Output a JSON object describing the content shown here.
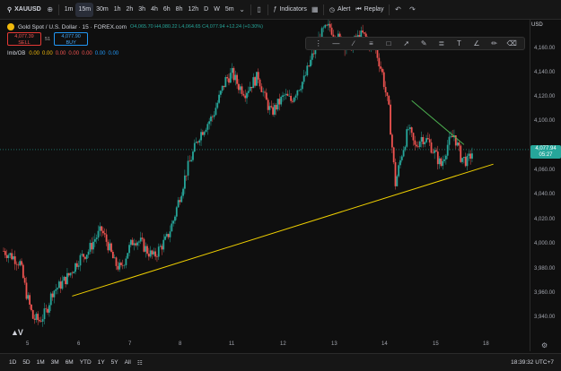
{
  "toolbar": {
    "symbol": "XAUUSD",
    "intervals": [
      "1m",
      "15m",
      "30m",
      "1h",
      "2h",
      "3h",
      "4h",
      "6h",
      "8h",
      "12h",
      "D",
      "W",
      "5m"
    ],
    "active_interval": "15m",
    "indicators_label": "Indicators",
    "alert_label": "Alert",
    "replay_label": "Replay"
  },
  "legend": {
    "title": "Gold Spot / U.S. Dollar · 15 · FOREX.com",
    "ohlc": "O4,065.70 H4,080.22 L4,064.65 C4,077.94 +12.24 (+0.30%)",
    "sell_price": "4,077.39",
    "sell_label": "SELL",
    "buy_price": "4,077.90",
    "buy_label": "BUY",
    "spread": "51",
    "indicator_name": "Imb/OB",
    "indicator_values": [
      "0.00",
      "0.00",
      "0.00",
      "0.00",
      "0.00",
      "0.00",
      "0.00"
    ]
  },
  "price_axis": {
    "currency": "USD",
    "labels": [
      "4,160.00",
      "4,140.00",
      "4,120.00",
      "4,100.00",
      "4,080.00",
      "4,060.00",
      "4,040.00",
      "4,020.00",
      "4,000.00",
      "3,980.00",
      "3,960.00",
      "3,940.00"
    ],
    "current_price": "4,077.94",
    "countdown": "05:27"
  },
  "time_axis": {
    "labels": [
      "5",
      "6",
      "7",
      "8",
      "11",
      "12",
      "13",
      "14",
      "15",
      "18"
    ]
  },
  "bottom_bar": {
    "ranges": [
      "1D",
      "5D",
      "1M",
      "3M",
      "6M",
      "YTD",
      "1Y",
      "5Y",
      "All"
    ],
    "clock": "18:39:32 UTC+7"
  },
  "colors": {
    "bull": "#26a69a",
    "bear": "#ef5350",
    "support_line": "#f0d000",
    "resistance_line": "#4caf50",
    "background": "#0f0f0f"
  },
  "chart_data": {
    "type": "candlestick",
    "symbol": "XAUUSD",
    "timeframe": "15",
    "ylim": [
      3930,
      4180
    ],
    "x_ticks": [
      "5",
      "6",
      "7",
      "8",
      "11",
      "12",
      "13",
      "14",
      "15",
      "18"
    ],
    "close_path": [
      [
        0,
        3995
      ],
      [
        3,
        3990
      ],
      [
        5,
        3985
      ],
      [
        7,
        3960
      ],
      [
        9,
        3940
      ],
      [
        11,
        3938
      ],
      [
        13,
        3945
      ],
      [
        15,
        3962
      ],
      [
        17,
        3966
      ],
      [
        20,
        3975
      ],
      [
        23,
        3988
      ],
      [
        26,
        3995
      ],
      [
        28,
        4005
      ],
      [
        30,
        4012
      ],
      [
        32,
        4000
      ],
      [
        34,
        3985
      ],
      [
        36,
        3980
      ],
      [
        38,
        3995
      ],
      [
        40,
        4005
      ],
      [
        42,
        4002
      ],
      [
        44,
        3995
      ],
      [
        46,
        3990
      ],
      [
        48,
        3998
      ],
      [
        50,
        4005
      ],
      [
        52,
        4020
      ],
      [
        54,
        4040
      ],
      [
        56,
        4060
      ],
      [
        58,
        4075
      ],
      [
        60,
        4090
      ],
      [
        62,
        4098
      ],
      [
        64,
        4105
      ],
      [
        66,
        4120
      ],
      [
        68,
        4135
      ],
      [
        70,
        4140
      ],
      [
        72,
        4130
      ],
      [
        74,
        4125
      ],
      [
        76,
        4132
      ],
      [
        78,
        4138
      ],
      [
        80,
        4120
      ],
      [
        82,
        4108
      ],
      [
        84,
        4115
      ],
      [
        86,
        4122
      ],
      [
        88,
        4118
      ],
      [
        90,
        4128
      ],
      [
        92,
        4135
      ],
      [
        94,
        4150
      ],
      [
        96,
        4165
      ],
      [
        98,
        4175
      ],
      [
        100,
        4178
      ],
      [
        102,
        4170
      ],
      [
        104,
        4165
      ],
      [
        106,
        4162
      ],
      [
        108,
        4168
      ],
      [
        110,
        4172
      ],
      [
        112,
        4165
      ],
      [
        114,
        4160
      ],
      [
        116,
        4140
      ],
      [
        118,
        4110
      ],
      [
        120,
        4050
      ],
      [
        122,
        4075
      ],
      [
        124,
        4095
      ],
      [
        126,
        4080
      ],
      [
        128,
        4088
      ],
      [
        130,
        4085
      ],
      [
        132,
        4075
      ],
      [
        134,
        4065
      ],
      [
        136,
        4082
      ],
      [
        138,
        4090
      ],
      [
        140,
        4072
      ],
      [
        142,
        4068
      ],
      [
        144,
        4078
      ]
    ],
    "trendlines": [
      {
        "name": "support",
        "from": [
          21,
          3958
        ],
        "to": [
          150,
          4066
        ]
      },
      {
        "name": "resistance",
        "from": [
          125,
          4118
        ],
        "to": [
          141,
          4082
        ]
      }
    ],
    "last_close": 4077.94
  }
}
